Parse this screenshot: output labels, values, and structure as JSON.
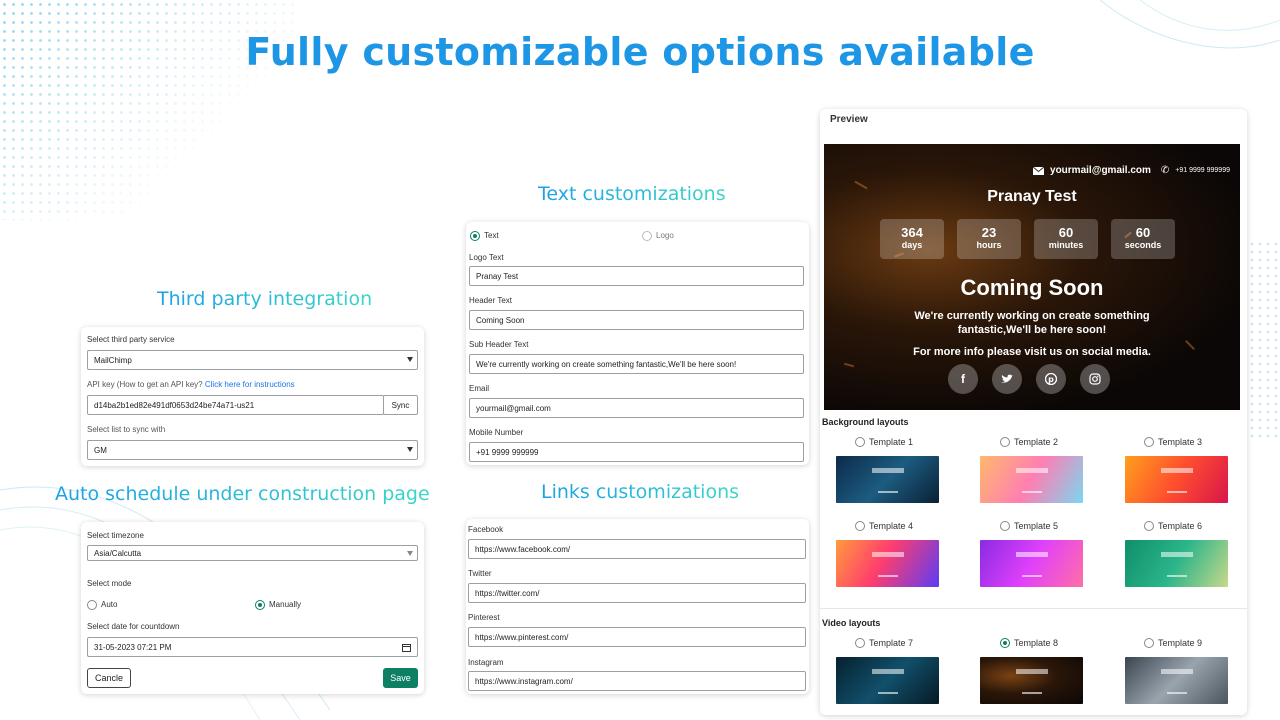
{
  "main_title": "Fully customizable options available",
  "sections": {
    "third_party": "Third party integration",
    "auto_schedule": "Auto schedule under construction page",
    "text_custom": "Text customizations",
    "links_custom": "Links customizations"
  },
  "third_party": {
    "service_label": "Select third party service",
    "service_value": "MailChimp",
    "api_label": "API key (How to get an API key?",
    "api_link": "Click here for instructions",
    "api_value": "d14ba2b1ed82e491df0653d24be74a71-us21",
    "sync_label": "Sync",
    "list_label": "Select list to sync with",
    "list_value": "GM"
  },
  "schedule": {
    "timezone_label": "Select timezone",
    "timezone_value": "Asia/Calcutta",
    "mode_label": "Select mode",
    "mode_auto": "Auto",
    "mode_manual": "Manually",
    "mode_selected": "Manually",
    "date_label": "Select date for countdown",
    "date_value": "31-05-2023 07:21 PM",
    "cancel_label": "Cancle",
    "save_label": "Save"
  },
  "text_form": {
    "opt_text": "Text",
    "opt_logo": "Logo",
    "selected": "Text",
    "logo_text_label": "Logo Text",
    "logo_text_value": "Pranay Test",
    "header_label": "Header Text",
    "header_value": "Coming Soon",
    "sub_header_label": "Sub Header Text",
    "sub_header_value": "We're currently working on create something fantastic,We'll be here soon!",
    "email_label": "Email",
    "email_value": "yourmail@gmail.com",
    "mobile_label": "Mobile Number",
    "mobile_value": "+91 9999 999999"
  },
  "links_form": {
    "facebook_label": "Facebook",
    "facebook_value": "https://www.facebook.com/",
    "twitter_label": "Twitter",
    "twitter_value": "https://twitter.com/",
    "pinterest_label": "Pinterest",
    "pinterest_value": "https://www.pinterest.com/",
    "instagram_label": "Instagram",
    "instagram_value": "https://www.instagram.com/"
  },
  "preview": {
    "title": "Preview",
    "email": "yourmail@gmail.com",
    "phone": "+91 9999 999999",
    "logo_text": "Pranay Test",
    "countdown": [
      {
        "num": "364",
        "unit": "days"
      },
      {
        "num": "23",
        "unit": "hours"
      },
      {
        "num": "60",
        "unit": "minutes"
      },
      {
        "num": "60",
        "unit": "seconds"
      }
    ],
    "header": "Coming Soon",
    "sub_header": "We're currently working on create something fantastic,We'll be here soon!",
    "more_info": "For more info please visit us on social media.",
    "social_icons": [
      "facebook-icon",
      "twitter-icon",
      "pinterest-icon",
      "instagram-icon"
    ],
    "bg_layouts_title": "Background layouts",
    "video_layouts_title": "Video layouts",
    "templates": [
      "Template 1",
      "Template 2",
      "Template 3",
      "Template 4",
      "Template 5",
      "Template 6",
      "Template 7",
      "Template 8",
      "Template 9"
    ],
    "selected_template": "Template 8"
  },
  "colors": {
    "title_blue": "#1e96e6",
    "accent_green": "#0d7f63",
    "link_blue": "#1a73e8"
  }
}
